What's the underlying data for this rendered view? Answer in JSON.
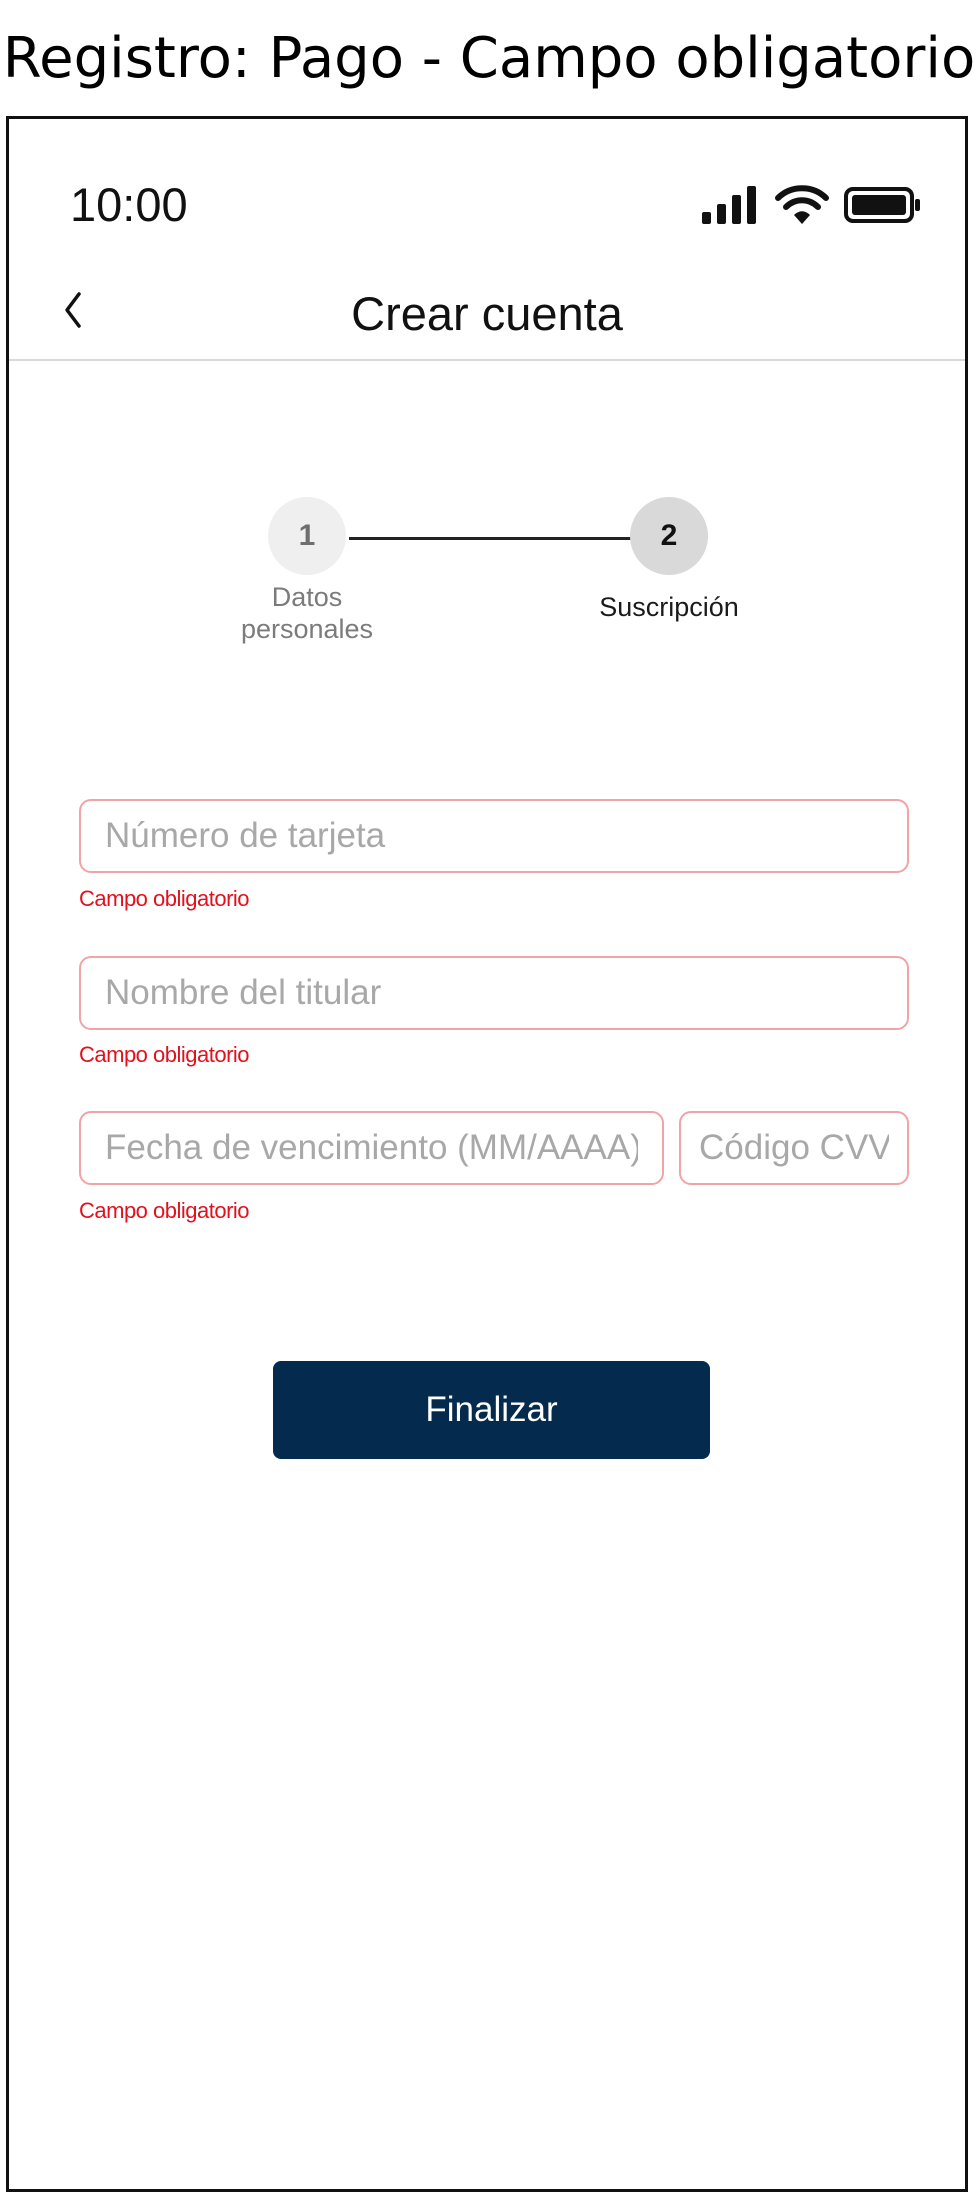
{
  "caption": "Registro: Pago - Campo obligatorio",
  "status_bar": {
    "time": "10:00",
    "icons": [
      "signal-icon",
      "wifi-icon",
      "battery-icon"
    ]
  },
  "header": {
    "back_icon": "chevron-left-icon",
    "title": "Crear cuenta"
  },
  "stepper": {
    "steps": [
      {
        "number": "1",
        "label": "Datos personales",
        "state": "completed"
      },
      {
        "number": "2",
        "label": "Suscripción",
        "state": "active"
      }
    ]
  },
  "form": {
    "card_number": {
      "placeholder": "Número de tarjeta",
      "value": "",
      "error": "Campo obligatorio"
    },
    "holder_name": {
      "placeholder": "Nombre del titular",
      "value": "",
      "error": "Campo obligatorio"
    },
    "expiry": {
      "placeholder": "Fecha de vencimiento (MM/AAAA)",
      "value": "",
      "error": "Campo obligatorio"
    },
    "cvv": {
      "placeholder": "Código CVV",
      "value": ""
    }
  },
  "actions": {
    "finish_label": "Finalizar"
  },
  "colors": {
    "primary_button": "#042a4d",
    "error_text": "#e1121d",
    "error_border": "#f1a3a6",
    "divider": "#d9d9d9"
  }
}
